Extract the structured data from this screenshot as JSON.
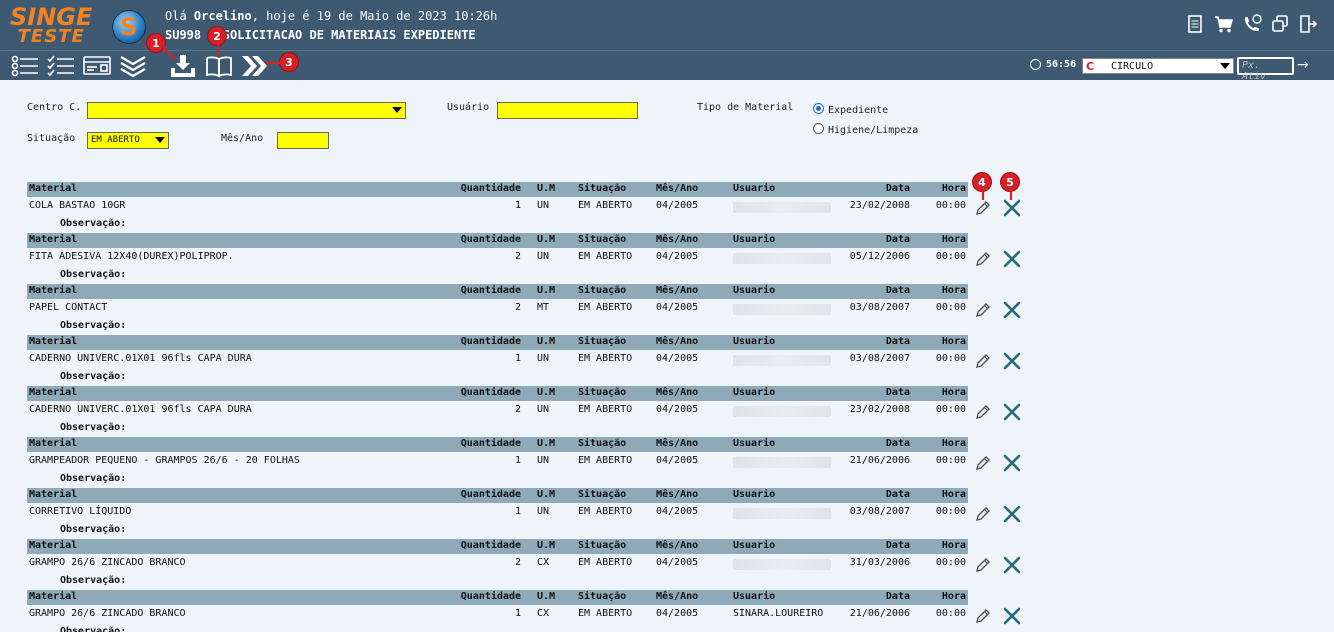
{
  "header": {
    "logo_line1": "SINGE",
    "logo_line2": "TESTE",
    "greeting_prefix": "Olá ",
    "user_name": "Orcelino",
    "greeting_suffix": ", hoje é 19 de Maio de 2023 10:26h",
    "screen_title": "SU998 - SOLICITACAO DE MATERIAIS EXPEDIENTE",
    "icons": [
      "document-icon",
      "cart-icon",
      "phone-chat-icon",
      "copy-windows-icon",
      "exit-icon"
    ]
  },
  "toolbar": {
    "session_timer": "56:56",
    "company": "CIRCULO",
    "next_activity_placeholder": "Px. Ativ",
    "markers": [
      "1",
      "2",
      "3",
      "4",
      "5"
    ]
  },
  "filters": {
    "centro_label": "Centro C.",
    "usuario_label": "Usuário",
    "tipo_label": "Tipo de Material",
    "situacao_label": "Situação",
    "situacao_value": "EM ABERTO",
    "mesano_label": "Mês/Ano",
    "tipo_options": [
      "Expediente",
      "Higiene/Limpeza"
    ],
    "tipo_selected": "Expediente"
  },
  "table": {
    "headers": {
      "material": "Material",
      "quantidade": "Quantidade",
      "um": "U.M",
      "situacao": "Situação",
      "mesano": "Mês/Ano",
      "usuario": "Usuario",
      "data": "Data",
      "hora": "Hora"
    },
    "obs_label": "Observação:",
    "rows": [
      {
        "material": "COLA BASTAO 10GR",
        "qtd": "1",
        "um": "UN",
        "situacao": "EM ABERTO",
        "mesano": "04/2005",
        "usuario": "",
        "data": "23/02/2008",
        "hora": "00:00"
      },
      {
        "material": "FITA ADESIVA 12X40(DUREX)POLIPROP.",
        "qtd": "2",
        "um": "UN",
        "situacao": "EM ABERTO",
        "mesano": "04/2005",
        "usuario": "",
        "data": "05/12/2006",
        "hora": "00:00"
      },
      {
        "material": "PAPEL CONTACT",
        "qtd": "2",
        "um": "MT",
        "situacao": "EM ABERTO",
        "mesano": "04/2005",
        "usuario": "",
        "data": "03/08/2007",
        "hora": "00:00"
      },
      {
        "material": "CADERNO UNIVERC.01X01 96fls CAPA DURA",
        "qtd": "1",
        "um": "UN",
        "situacao": "EM ABERTO",
        "mesano": "04/2005",
        "usuario": "",
        "data": "03/08/2007",
        "hora": "00:00"
      },
      {
        "material": "CADERNO UNIVERC.01X01 96fls CAPA DURA",
        "qtd": "2",
        "um": "UN",
        "situacao": "EM ABERTO",
        "mesano": "04/2005",
        "usuario": "",
        "data": "23/02/2008",
        "hora": "00:00"
      },
      {
        "material": "GRAMPEADOR PEQUENO - GRAMPOS 26/6 - 20 FOLHAS",
        "qtd": "1",
        "um": "UN",
        "situacao": "EM ABERTO",
        "mesano": "04/2005",
        "usuario": "",
        "data": "21/06/2006",
        "hora": "00:00"
      },
      {
        "material": "CORRETIVO LÍQUIDO",
        "qtd": "1",
        "um": "UN",
        "situacao": "EM ABERTO",
        "mesano": "04/2005",
        "usuario": "",
        "data": "03/08/2007",
        "hora": "00:00"
      },
      {
        "material": "GRAMPO 26/6 ZINCADO BRANCO",
        "qtd": "2",
        "um": "CX",
        "situacao": "EM ABERTO",
        "mesano": "04/2005",
        "usuario": "",
        "data": "31/03/2006",
        "hora": "00:00"
      },
      {
        "material": "GRAMPO 26/6 ZINCADO BRANCO",
        "qtd": "1",
        "um": "CX",
        "situacao": "EM ABERTO",
        "mesano": "04/2005",
        "usuario": "SINARA.LOUREIRO",
        "data": "21/06/2006",
        "hora": "00:00"
      }
    ]
  },
  "colors": {
    "header_bg": "#3d5a72",
    "logo_orange": "#f58220",
    "field_yellow": "#ffff00",
    "table_header": "#8eaab8",
    "marker_red": "#d42027",
    "action_teal": "#2a6a7a"
  }
}
